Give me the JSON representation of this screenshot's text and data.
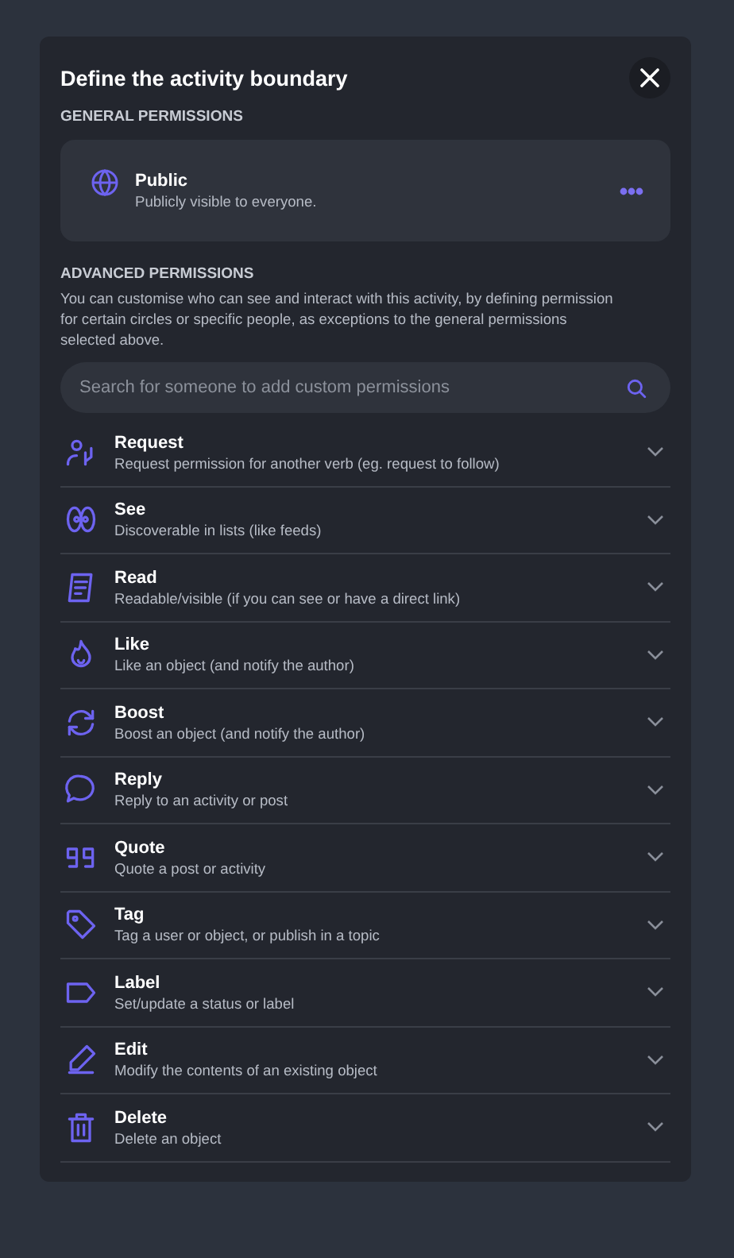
{
  "dialog": {
    "title": "Define the activity boundary"
  },
  "general": {
    "heading": "GENERAL PERMISSIONS",
    "option": {
      "title": "Public",
      "description": "Publicly visible to everyone."
    }
  },
  "advanced": {
    "heading": "ADVANCED PERMISSIONS",
    "description": "You can customise who can see and interact with this activity, by defining permission for certain circles or specific people, as exceptions to the general permissions selected above.",
    "search": {
      "placeholder": "Search for someone to add custom permissions"
    },
    "verbs": [
      {
        "kind": "request",
        "title": "Request",
        "description": "Request permission for another verb (eg. request to follow)",
        "expanded": false
      },
      {
        "kind": "see",
        "title": "See",
        "description": "Discoverable in lists (like feeds)",
        "expanded": false
      },
      {
        "kind": "read",
        "title": "Read",
        "description": "Readable/visible (if you can see or have a direct link)",
        "expanded": false
      },
      {
        "kind": "like",
        "title": "Like",
        "description": "Like an object (and notify the author)",
        "expanded": false
      },
      {
        "kind": "boost",
        "title": "Boost",
        "description": "Boost an object (and notify the author)",
        "expanded": false
      },
      {
        "kind": "reply",
        "title": "Reply",
        "description": "Reply to an activity or post",
        "expanded": false
      },
      {
        "kind": "quote",
        "title": "Quote",
        "description": "Quote a post or activity",
        "expanded": false
      },
      {
        "kind": "tag",
        "title": "Tag",
        "description": "Tag a user or object, or publish in a topic",
        "expanded": false
      },
      {
        "kind": "label",
        "title": "Label",
        "description": "Set/update a status or label",
        "expanded": false
      },
      {
        "kind": "edit",
        "title": "Edit",
        "description": "Modify the contents of an existing object",
        "expanded": false
      },
      {
        "kind": "delete",
        "title": "Delete",
        "description": "Delete an object",
        "expanded": false
      }
    ]
  }
}
